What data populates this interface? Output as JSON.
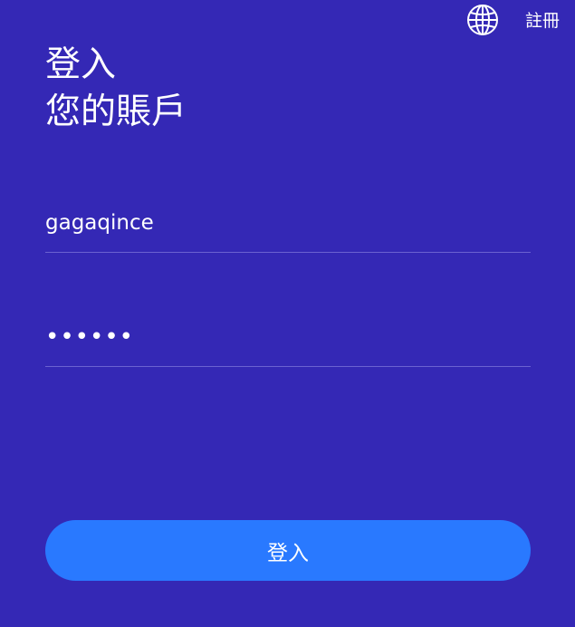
{
  "header": {
    "language_icon": "globe-icon",
    "register_label": "註冊"
  },
  "title": {
    "line1": "登入",
    "line2": "您的賬戶"
  },
  "form": {
    "username_value": "gagaqince",
    "password_value": "••••••",
    "submit_label": "登入"
  },
  "colors": {
    "background": "#3428b5",
    "button": "#2979ff",
    "text": "#ffffff",
    "divider": "#6b62d0"
  }
}
